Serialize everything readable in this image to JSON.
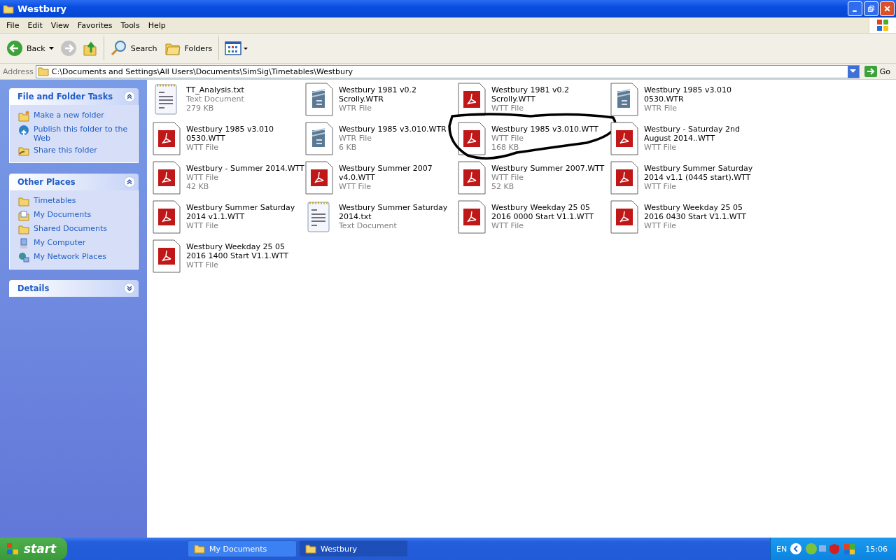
{
  "window": {
    "title": "Westbury"
  },
  "menu": [
    "File",
    "Edit",
    "View",
    "Favorites",
    "Tools",
    "Help"
  ],
  "toolbar": {
    "back": "Back",
    "search": "Search",
    "folders": "Folders"
  },
  "address": {
    "label": "Address",
    "value": "C:\\Documents and Settings\\All Users\\Documents\\SimSig\\Timetables\\Westbury",
    "go": "Go"
  },
  "panels": [
    {
      "title": "File and Folder Tasks",
      "expanded": true,
      "items": [
        {
          "label": "Make a new folder",
          "kind": "newfolder"
        },
        {
          "label": "Publish this folder to the Web",
          "kind": "globe"
        },
        {
          "label": "Share this folder",
          "kind": "share"
        }
      ]
    },
    {
      "title": "Other Places",
      "expanded": true,
      "items": [
        {
          "label": "Timetables",
          "kind": "folder"
        },
        {
          "label": "My Documents",
          "kind": "docs"
        },
        {
          "label": "Shared Documents",
          "kind": "folder"
        },
        {
          "label": "My Computer",
          "kind": "computer"
        },
        {
          "label": "My Network Places",
          "kind": "network"
        }
      ]
    },
    {
      "title": "Details",
      "expanded": false
    }
  ],
  "files": [
    {
      "name": "TT_Analysis.txt",
      "type": "Text Document",
      "size": "279 KB",
      "kind": "txt",
      "circled": false
    },
    {
      "name": "Westbury 1981 v0.2 Scrolly.WTR",
      "type": "WTR File",
      "kind": "wtr",
      "circled": false
    },
    {
      "name": "Westbury 1981 v0.2 Scrolly.WTT",
      "type": "WTT File",
      "kind": "wtt",
      "circled": false
    },
    {
      "name": "Westbury 1985 v3.010 0530.WTR",
      "type": "WTR File",
      "kind": "wtr",
      "circled": false
    },
    {
      "name": "Westbury 1985 v3.010 0530.WTT",
      "type": "WTT File",
      "kind": "wtt",
      "circled": false
    },
    {
      "name": "Westbury 1985 v3.010.WTR",
      "type": "WTR File",
      "size": "6 KB",
      "kind": "wtr",
      "circled": false
    },
    {
      "name": "Westbury 1985 v3.010.WTT",
      "type": "WTT File",
      "size": "168 KB",
      "kind": "wtt",
      "circled": true
    },
    {
      "name": "Westbury - Saturday 2nd August 2014..WTT",
      "type": "WTT File",
      "kind": "wtt",
      "circled": false
    },
    {
      "name": "Westbury - Summer 2014.WTT",
      "type": "WTT File",
      "size": "42 KB",
      "kind": "wtt",
      "circled": false
    },
    {
      "name": "Westbury Summer 2007 v4.0.WTT",
      "type": "WTT File",
      "kind": "wtt",
      "circled": false
    },
    {
      "name": "Westbury Summer 2007.WTT",
      "type": "WTT File",
      "size": "52 KB",
      "kind": "wtt",
      "circled": false
    },
    {
      "name": "Westbury Summer Saturday 2014 v1.1 (0445 start).WTT",
      "type": "WTT File",
      "kind": "wtt",
      "circled": false
    },
    {
      "name": "Westbury Summer Saturday 2014 v1.1.WTT",
      "type": "WTT File",
      "kind": "wtt",
      "circled": false
    },
    {
      "name": "Westbury Summer Saturday 2014.txt",
      "type": "Text Document",
      "kind": "txt",
      "circled": false
    },
    {
      "name": "Westbury Weekday 25 05 2016 0000 Start V1.1.WTT",
      "type": "WTT File",
      "kind": "wtt",
      "circled": false
    },
    {
      "name": "Westbury Weekday 25 05 2016 0430 Start V1.1.WTT",
      "type": "WTT File",
      "kind": "wtt",
      "circled": false
    },
    {
      "name": "Westbury Weekday 25 05 2016 1400 Start V1.1.WTT",
      "type": "WTT File",
      "kind": "wtt",
      "circled": false
    }
  ],
  "taskbar": {
    "start": "start",
    "buttons": [
      {
        "label": "My Documents",
        "selected": false
      },
      {
        "label": "Westbury",
        "selected": true
      }
    ],
    "language": "EN",
    "clock": "15:06"
  }
}
